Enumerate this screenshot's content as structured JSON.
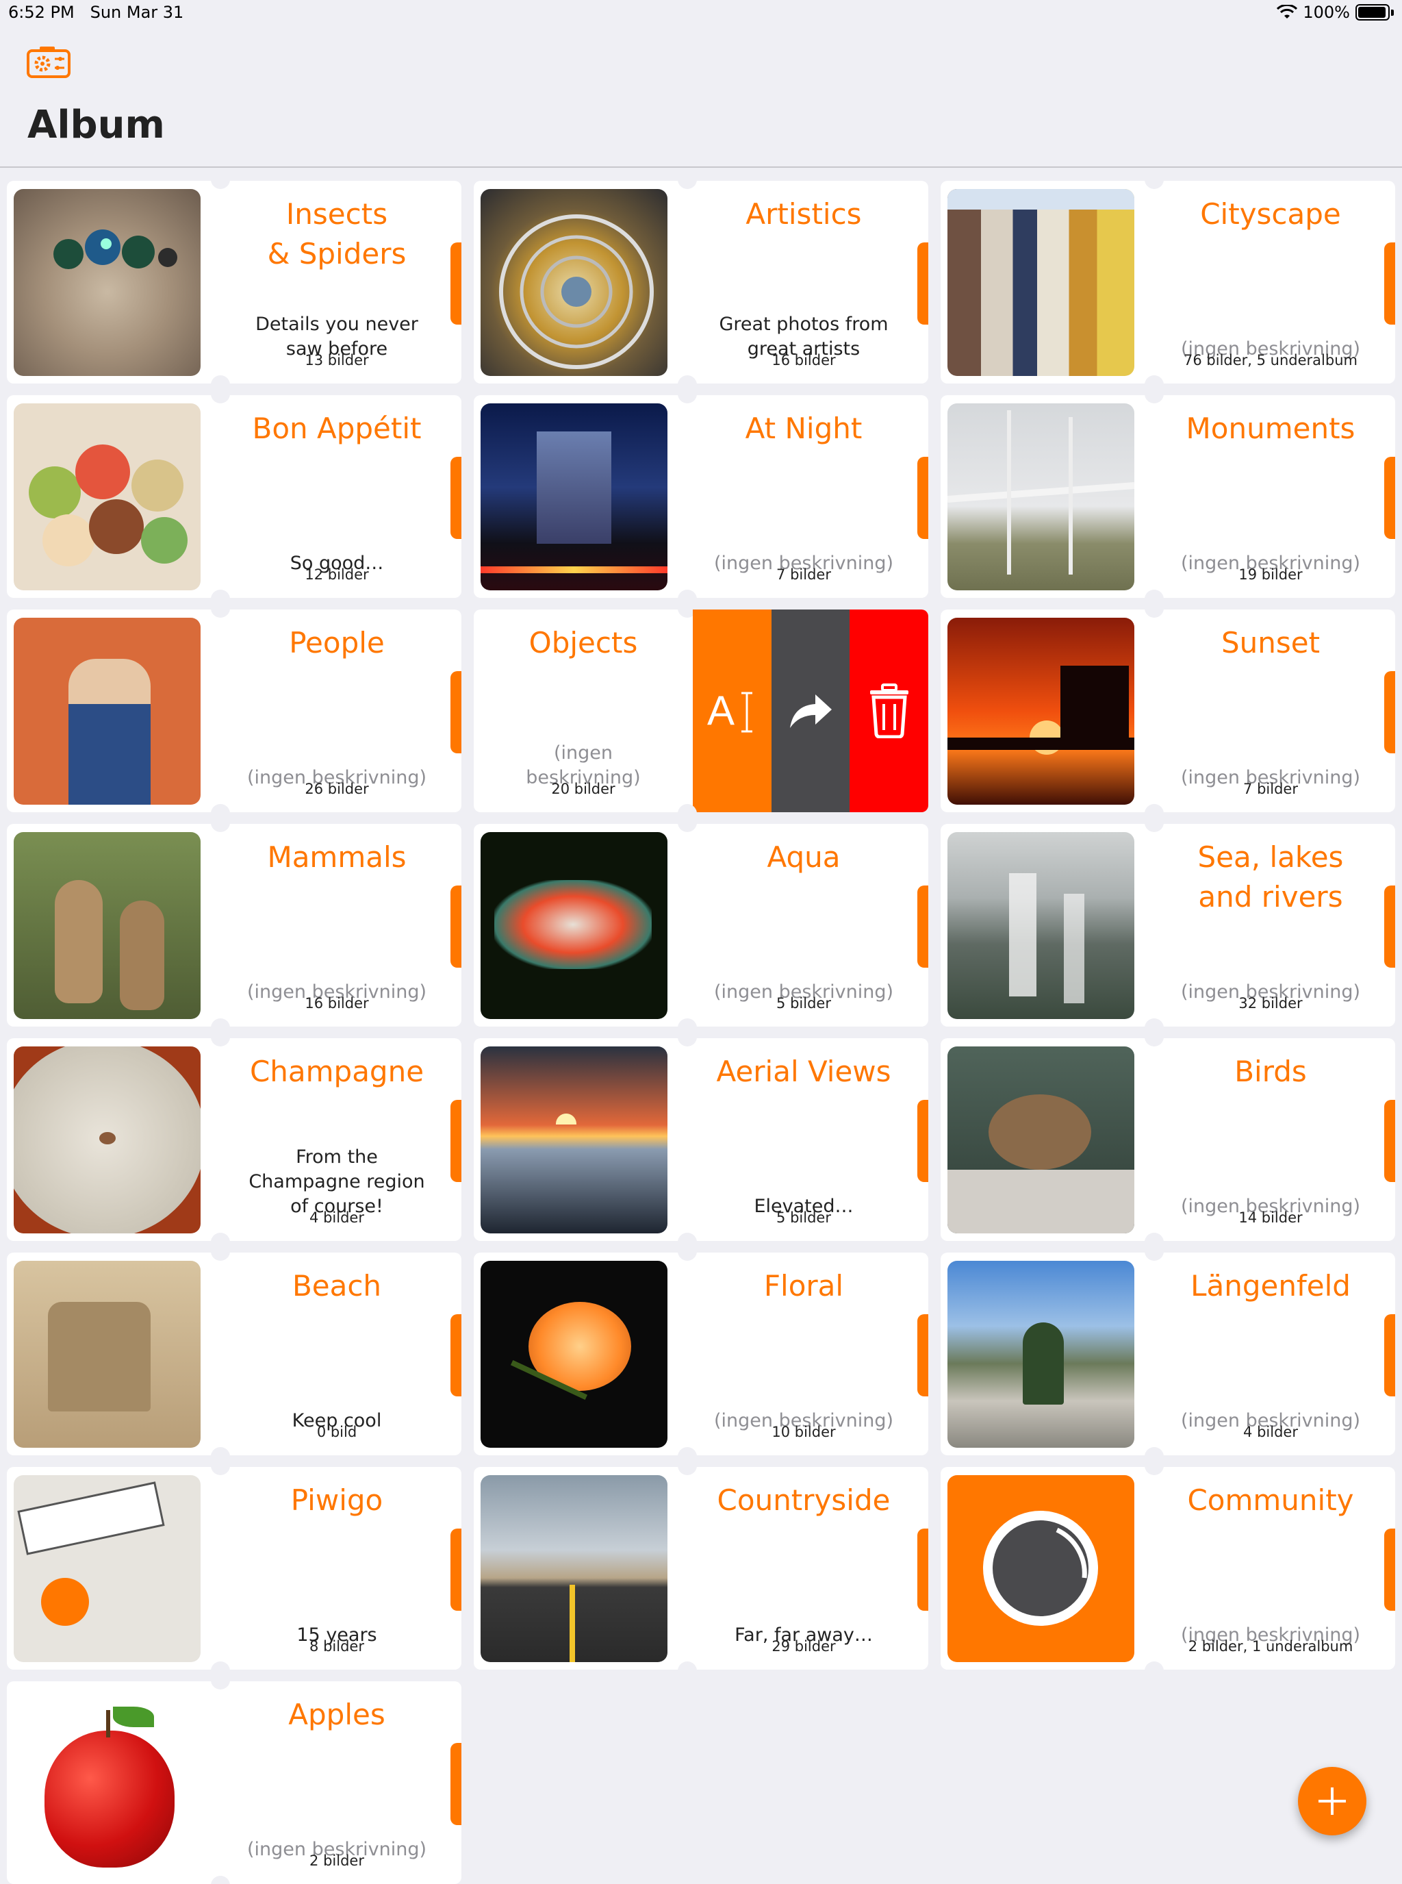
{
  "status_bar": {
    "time": "6:52 PM",
    "date": "Sun Mar 31",
    "battery": "100%"
  },
  "header": {
    "title": "Album",
    "settings_icon": "camera-gear-icon"
  },
  "colors": {
    "accent": "#ff7700",
    "background": "#efeff4",
    "move_action": "#4a4a4d",
    "delete_action": "#ff0000"
  },
  "albums": [
    {
      "title": "Insects\n& Spiders",
      "description": "Details you never saw before",
      "count": "13 bilder"
    },
    {
      "title": "Artistics",
      "description": "Great photos from great artists",
      "count": "16 bilder"
    },
    {
      "title": "Cityscape",
      "description": "(ingen beskrivning)",
      "count": "76 bilder, 5 underalbum"
    },
    {
      "title": "Bon Appétit",
      "description": "So good…",
      "count": "12 bilder"
    },
    {
      "title": "At Night",
      "description": "(ingen beskrivning)",
      "count": "7 bilder"
    },
    {
      "title": "Monuments",
      "description": "(ingen beskrivning)",
      "count": "19 bilder"
    },
    {
      "title": "People",
      "description": "(ingen beskrivning)",
      "count": "26 bilder"
    },
    {
      "title": "Objects",
      "description": "(ingen beskrivning)",
      "count": "20 bilder"
    },
    {
      "title": "Sunset",
      "description": "(ingen beskrivning)",
      "count": "7 bilder"
    },
    {
      "title": "Mammals",
      "description": "(ingen beskrivning)",
      "count": "16 bilder"
    },
    {
      "title": "Aqua",
      "description": "(ingen beskrivning)",
      "count": "5 bilder"
    },
    {
      "title": "Sea, lakes\nand rivers",
      "description": "(ingen beskrivning)",
      "count": "32 bilder"
    },
    {
      "title": "Champagne",
      "description": "From the Champagne region of course!",
      "count": "4 bilder"
    },
    {
      "title": "Aerial Views",
      "description": "Elevated…",
      "count": "5 bilder"
    },
    {
      "title": "Birds",
      "description": "(ingen beskrivning)",
      "count": "14 bilder"
    },
    {
      "title": "Beach",
      "description": "Keep cool",
      "count": "0 bild"
    },
    {
      "title": "Floral",
      "description": "(ingen beskrivning)",
      "count": "10 bilder"
    },
    {
      "title": "Längenfeld",
      "description": "(ingen beskrivning)",
      "count": "4 bilder"
    },
    {
      "title": "Piwigo",
      "description": "15 years",
      "count": "8 bilder"
    },
    {
      "title": "Countryside",
      "description": "Far, far away…",
      "count": "29 bilder"
    },
    {
      "title": "Community",
      "description": "(ingen beskrivning)",
      "count": "2 bilder, 1 underalbum"
    },
    {
      "title": "Apples",
      "description": "(ingen beskrivning)",
      "count": "2 bilder"
    }
  ],
  "swipe_actions": [
    {
      "name": "rename",
      "icon": "rename-text-icon",
      "glyph": "A"
    },
    {
      "name": "move",
      "icon": "move-arrow-icon"
    },
    {
      "name": "delete",
      "icon": "trash-icon"
    }
  ],
  "fab": {
    "icon": "plus-icon"
  }
}
